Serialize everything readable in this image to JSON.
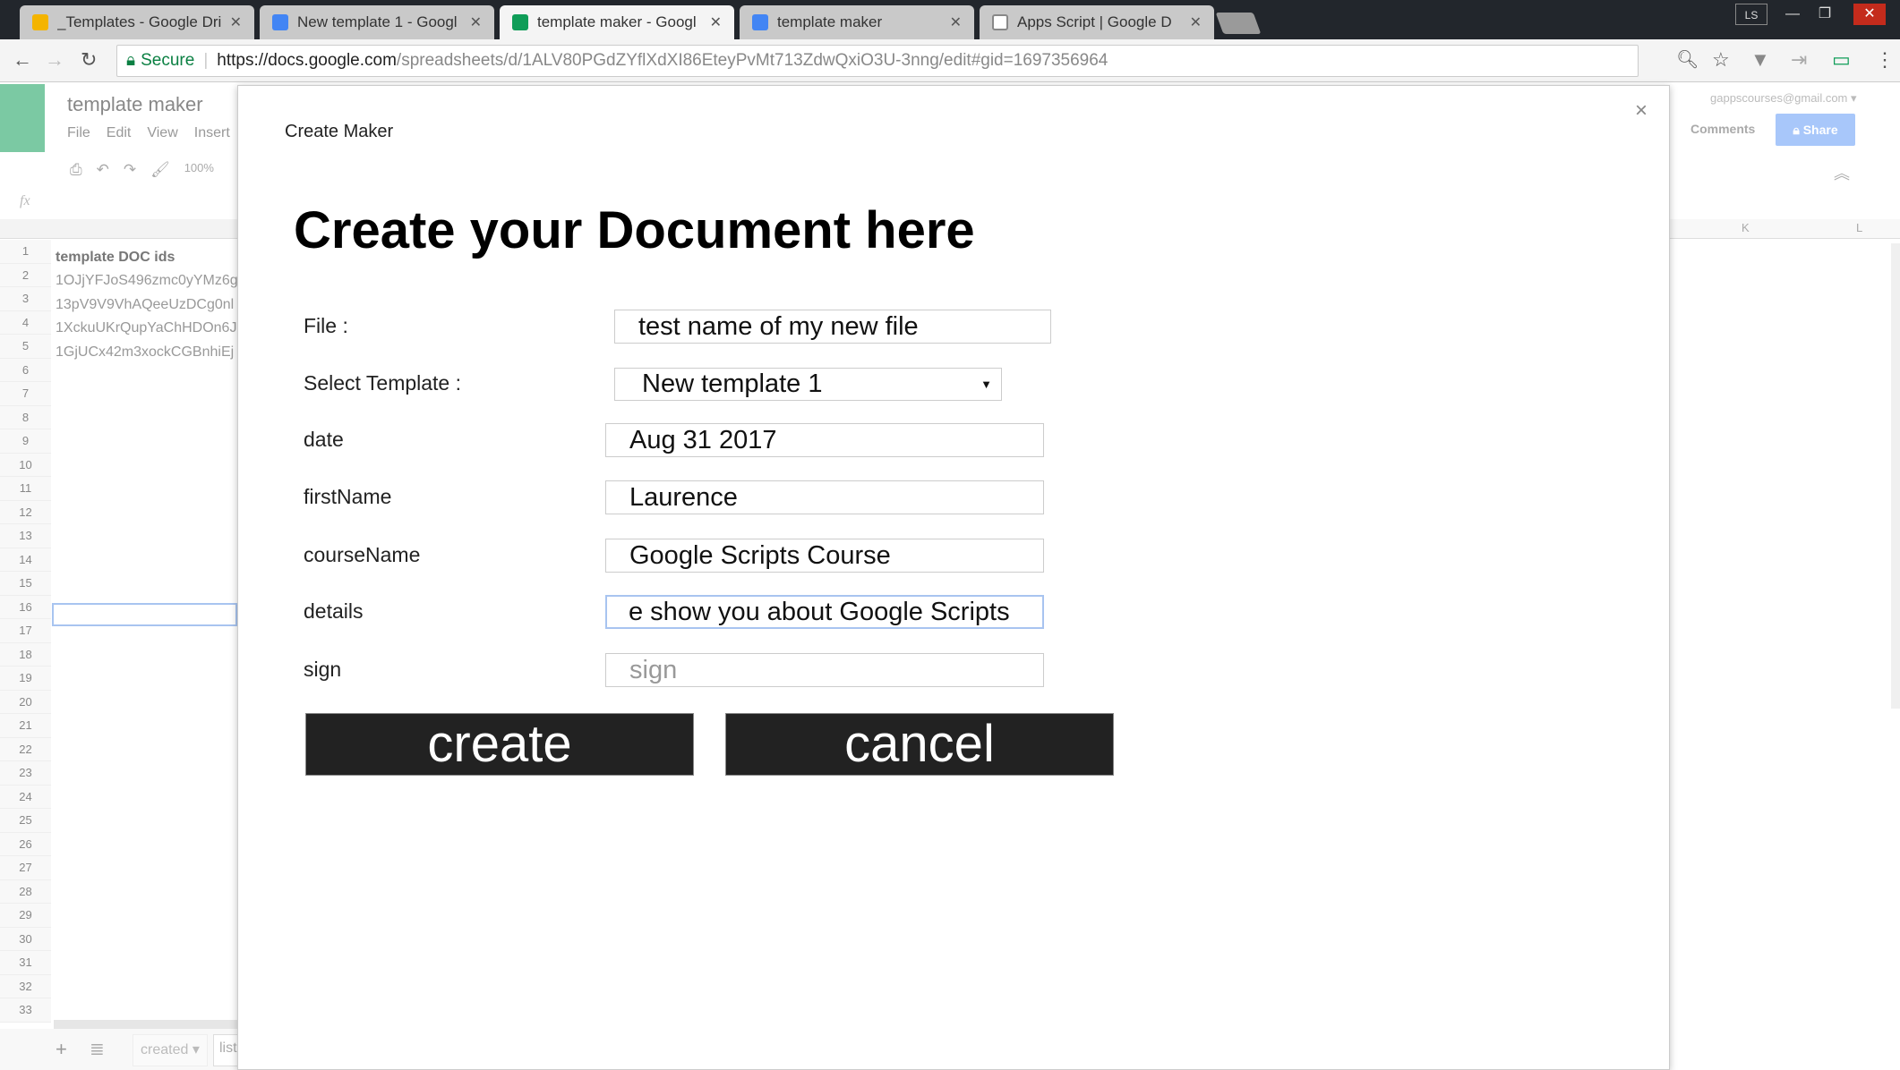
{
  "browser": {
    "tabs": [
      {
        "label": "_Templates - Google Dri",
        "icon": "google-drive-icon",
        "color": "#f4b400",
        "active": false
      },
      {
        "label": "New template 1 - Googl",
        "icon": "google-docs-icon",
        "color": "#4285f4",
        "active": false
      },
      {
        "label": "template maker - Googl",
        "icon": "google-sheets-icon",
        "color": "#0f9d58",
        "active": true
      },
      {
        "label": "template maker",
        "icon": "apps-script-arrow-icon",
        "color": "#4285f4",
        "active": false
      },
      {
        "label": "Apps Script | Google D",
        "icon": "apps-script-icon",
        "color": "#888888",
        "active": false
      }
    ],
    "secure_label": "Secure",
    "url_host": "https://docs.google.com",
    "url_path": "/spreadsheets/d/1ALV80PGdZYflXdXI86EteyPvMt713ZdwQxiO3U-3nng/edit#gid=1697356964",
    "profile_badge": "LS"
  },
  "sheets": {
    "title": "template maker",
    "menu": [
      "File",
      "Edit",
      "View",
      "Insert"
    ],
    "zoom": "100%",
    "fx": "fx",
    "account": "gappscourses@gmail.com",
    "comments_label": "Comments",
    "share_label": "Share",
    "columns": [
      "K",
      "L"
    ],
    "cells": [
      "template DOC ids",
      "1OJjYFJoS496zmc0yYMz6g",
      "13pV9V9VhAQeeUzDCg0nl",
      "1XckuUKrQupYaChHDOn6J",
      "1GjUCx42m3xockCGBnhiEj"
    ],
    "sheet_tabs": [
      "created",
      "list"
    ],
    "accent": "#0f9d58"
  },
  "dialog": {
    "title": "Create Maker",
    "heading": "Create your Document here",
    "fields": [
      {
        "label": "File :",
        "value": "test name of my new file",
        "placeholder": ""
      },
      {
        "label": "Select Template :",
        "value": "New template 1",
        "placeholder": ""
      },
      {
        "label": "date",
        "value": "Aug 31 2017",
        "placeholder": ""
      },
      {
        "label": "firstName",
        "value": "Laurence",
        "placeholder": ""
      },
      {
        "label": "courseName",
        "value": "Google Scripts Course",
        "placeholder": ""
      },
      {
        "label": "details",
        "value": "e show you about Google Scripts",
        "placeholder": ""
      },
      {
        "label": "sign",
        "value": "",
        "placeholder": "sign"
      }
    ],
    "create_label": "create",
    "cancel_label": "cancel"
  }
}
